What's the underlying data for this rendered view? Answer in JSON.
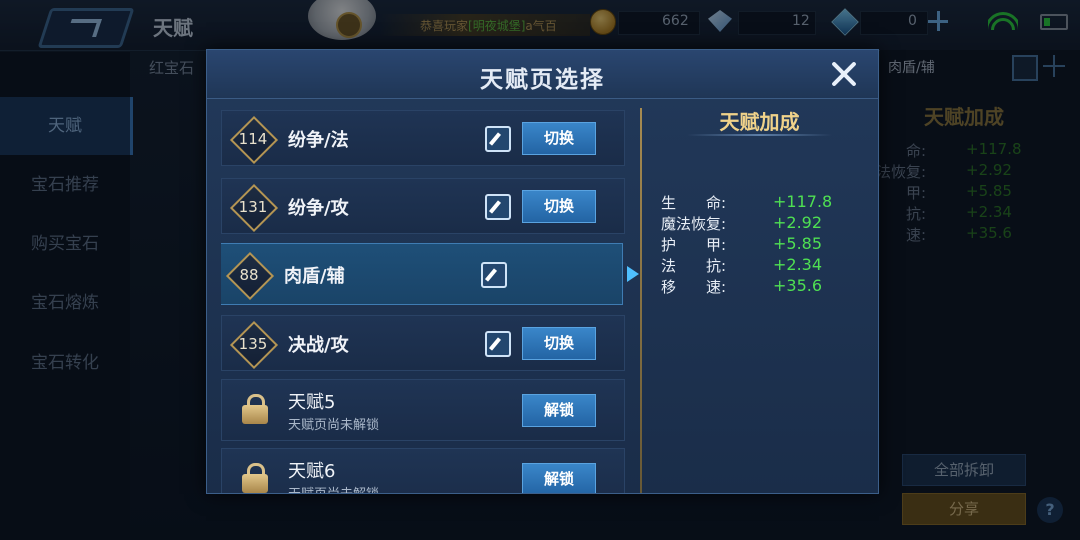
{
  "header": {
    "title": "天赋",
    "marquee_prefix": "恭喜玩家",
    "marquee_highlight": "[明夜城堡]",
    "marquee_suffix": "a气百",
    "gold": "662",
    "diamonds": "12",
    "crystals": "0"
  },
  "sidebar": {
    "items": [
      {
        "label": "天赋",
        "active": true
      },
      {
        "label": "宝石推荐",
        "active": false
      },
      {
        "label": "购买宝石",
        "active": false
      },
      {
        "label": "宝石熔炼",
        "active": false
      },
      {
        "label": "宝石转化",
        "active": false
      }
    ]
  },
  "background": {
    "subtitle": "红宝石",
    "current_page_tab": "肉盾/辅",
    "bonus_heading": "天赋加成",
    "stats": [
      {
        "label": "命:",
        "value": "+117.8"
      },
      {
        "label": "法恢复:",
        "value": "+2.92"
      },
      {
        "label": "甲:",
        "value": "+5.85"
      },
      {
        "label": "抗:",
        "value": "+2.34"
      },
      {
        "label": "速:",
        "value": "+35.6"
      }
    ],
    "reset_all_label": "全部拆卸",
    "share_label": "分享",
    "help_label": "?"
  },
  "modal": {
    "title": "天赋页选择",
    "pages": [
      {
        "level": "114",
        "name": "纷争/法",
        "action": "切换"
      },
      {
        "level": "131",
        "name": "纷争/攻",
        "action": "切换"
      },
      {
        "level": "88",
        "name": "肉盾/辅",
        "selected": true
      },
      {
        "level": "135",
        "name": "决战/攻",
        "action": "切换"
      }
    ],
    "locked_pages": [
      {
        "name": "天赋5",
        "subtitle": "天赋页尚未解锁",
        "action": "解锁"
      },
      {
        "name": "天赋6",
        "subtitle": "天赋页尚未解锁",
        "action": "解锁"
      }
    ],
    "bonus": {
      "title": "天赋加成",
      "stats": [
        {
          "label": "生　　命:",
          "value": "+117.8"
        },
        {
          "label": "魔法恢复:",
          "value": "+2.92"
        },
        {
          "label": "护　　甲:",
          "value": "+5.85"
        },
        {
          "label": "法　　抗:",
          "value": "+2.34"
        },
        {
          "label": "移　　速:",
          "value": "+35.6"
        }
      ]
    }
  },
  "colors": {
    "accent_blue": "#2f74b6",
    "stat_green": "#4fe052",
    "title_gold": "#f0d28a"
  }
}
